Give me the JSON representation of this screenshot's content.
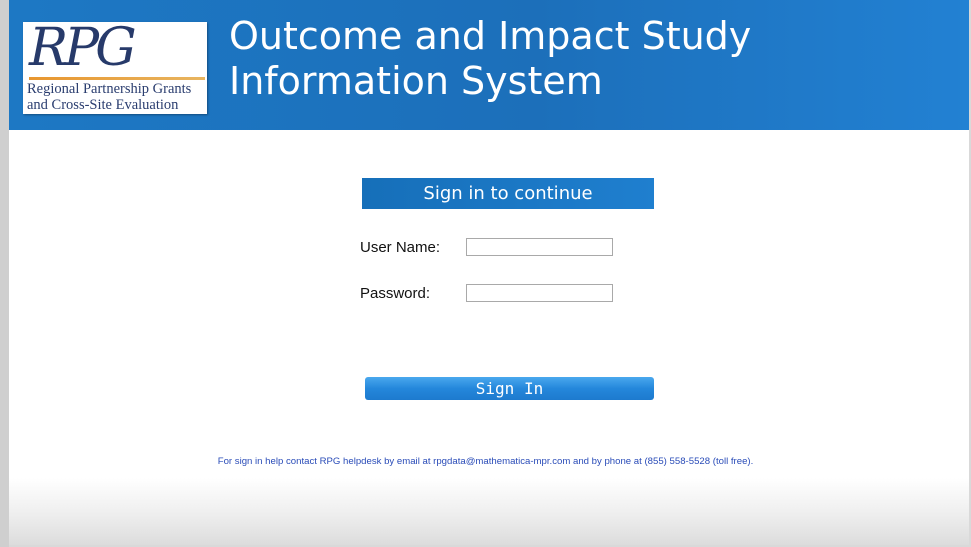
{
  "header": {
    "logo": {
      "mark": "RPG",
      "line1": "Regional Partnership Grants",
      "line2": "and Cross-Site Evaluation"
    },
    "title_line1": "Outcome and Impact Study",
    "title_line2": "Information System"
  },
  "login": {
    "banner": "Sign in to continue",
    "username_label": "User Name:",
    "username_value": "",
    "password_label": "Password:",
    "password_value": "",
    "submit_label": "Sign In"
  },
  "help_text": "For sign in help contact RPG helpdesk by email at rpgdata@mathematica-mpr.com and by phone at (855) 558-5528 (toll free).",
  "colors": {
    "header_blue": "#1c6fba",
    "button_blue": "#2487db",
    "help_text": "#2a4cb8"
  }
}
